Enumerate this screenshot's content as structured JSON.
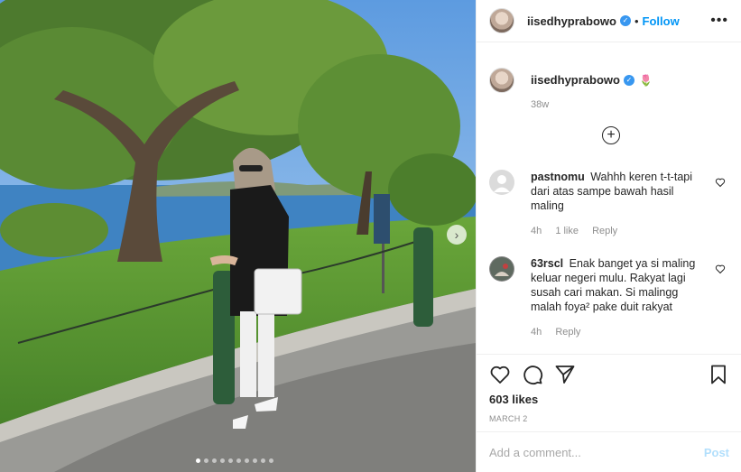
{
  "post": {
    "username": "iisedhyprabowo",
    "follow_label": "Follow",
    "more_label": "•••",
    "caption_emoji": "🌷",
    "time": "38w",
    "load_more_label": "+",
    "likes": "603 likes",
    "date": "MARCH 2",
    "carousel": {
      "total": 10,
      "active_index": 0
    }
  },
  "comments": [
    {
      "user": "pastnomu",
      "text": "Wahhh keren t-t-tapi dari atas sampe bawah hasil maling",
      "time": "4h",
      "likes": "1 like",
      "reply": "Reply"
    },
    {
      "user": "63rscl",
      "text": "Enak banget ya si maling keluar negeri mulu. Rakyat lagi susah cari makan. Si malingg malah foya² pake duit rakyat",
      "time": "4h",
      "reply": "Reply"
    }
  ],
  "add_comment": {
    "placeholder": "Add a comment...",
    "post_label": "Post"
  },
  "icons": {
    "verified": "verified-badge-icon",
    "like": "heart-icon",
    "comment": "comment-icon",
    "share": "paper-plane-icon",
    "save": "bookmark-icon"
  },
  "colors": {
    "accent": "#0095f6",
    "verified": "#3897f0",
    "muted": "#8e8e8e",
    "post_disabled": "#b2dffc"
  }
}
